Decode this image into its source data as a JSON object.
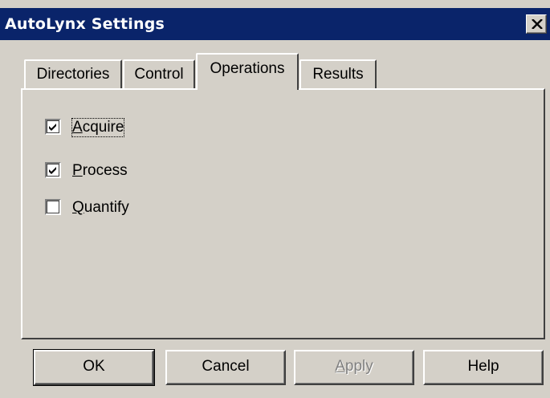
{
  "window": {
    "title": "AutoLynx Settings",
    "close_icon": "close-icon"
  },
  "tabs": [
    {
      "label": "Directories",
      "selected": false
    },
    {
      "label": "Control",
      "selected": false
    },
    {
      "label": "Operations",
      "selected": true
    },
    {
      "label": "Results",
      "selected": false
    }
  ],
  "operations": {
    "checkboxes": [
      {
        "label_prefix": "",
        "label_accel": "A",
        "label_rest": "cquire",
        "checked": true,
        "focused": true
      },
      {
        "label_prefix": "",
        "label_accel": "P",
        "label_rest": "rocess",
        "checked": true,
        "focused": false
      },
      {
        "label_prefix": "",
        "label_accel": "Q",
        "label_rest": "uantify",
        "checked": false,
        "focused": false
      }
    ]
  },
  "buttons": {
    "ok": "OK",
    "cancel": "Cancel",
    "apply_accel": "A",
    "apply_rest": "pply",
    "help": "Help"
  },
  "colors": {
    "titlebar": "#0a246a",
    "face": "#d4d0c8"
  }
}
